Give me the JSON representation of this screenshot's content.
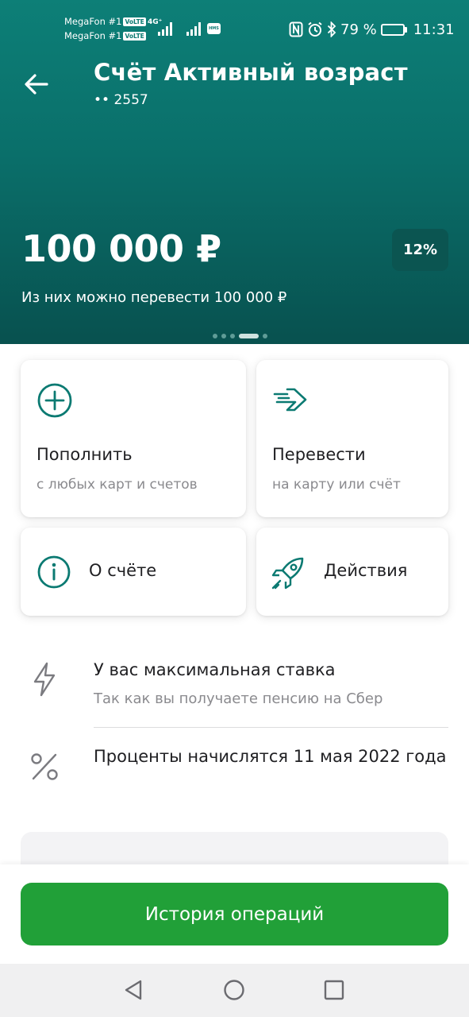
{
  "status_bar": {
    "carrier1": "MegaFon #1",
    "carrier2": "MegaFon #1",
    "volte_label": "VoLTE",
    "network_type": "4G⁺",
    "hms_label": "HMS",
    "battery_percent": "79 %",
    "battery_level": 0.79,
    "time": "11:31",
    "icons": [
      "nfc-icon",
      "alarm-icon",
      "bluetooth-icon",
      "battery-icon"
    ]
  },
  "header": {
    "title": "Счёт Активный возраст",
    "account_number": "•• 2557",
    "balance": "100 000 ₽",
    "rate": "12%",
    "available_text": "Из них можно перевести 100 000 ₽",
    "page_indicator": {
      "count": 5,
      "active_index": 3
    }
  },
  "actions": [
    {
      "icon": "plus-circle-icon",
      "title": "Пополнить",
      "subtitle": "с любых карт и счетов"
    },
    {
      "icon": "transfer-arrow-icon",
      "title": "Перевести",
      "subtitle": "на карту или счёт"
    },
    {
      "icon": "info-icon",
      "title": "О счёте"
    },
    {
      "icon": "rocket-icon",
      "title": "Действия"
    }
  ],
  "info": [
    {
      "icon": "lightning-icon",
      "title": "У вас максимальная ставка",
      "subtitle": "Так как вы получаете пенсию на Сбер"
    },
    {
      "icon": "percent-icon",
      "title": "Проценты начислятся 11 мая 2022 года"
    }
  ],
  "history_button": {
    "label": "История операций"
  },
  "nav_bar": {
    "icons": [
      "back-triangle-icon",
      "home-circle-icon",
      "recents-square-icon"
    ]
  },
  "colors": {
    "header_top": "#0d7f77",
    "header_bottom": "#08514f",
    "accent": "#0b7a72",
    "primary_button": "#21a038",
    "secondary_text": "#8a8a8e"
  }
}
